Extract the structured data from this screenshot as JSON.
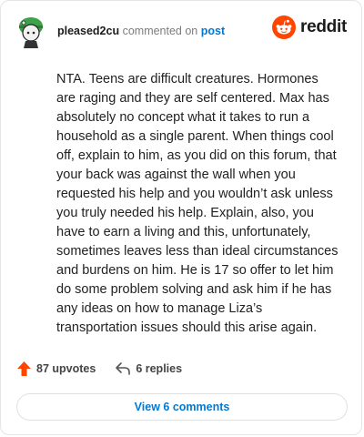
{
  "comment": {
    "username": "pleased2cu",
    "verb": "commented on",
    "post_link": "post",
    "body": "NTA. Teens are difficult creatures. Hormones are raging and they are self centered. Max has absolutely no concept what it takes to run a household as a single parent. When things cool off, explain to him, as you did on this forum, that your back was against the wall when you requested his help and you wouldn’t ask unless you truly needed his help. Explain, also, you have to earn a living and this, unfortunately, sometimes leaves less than ideal circumstances and burdens on him. He is 17 so offer to let him do some problem solving and ask him if he has any ideas on how to manage Liza’s transportation issues should this arise again.",
    "upvotes": "87 upvotes",
    "replies": "6 replies",
    "view_comments": "View 6 comments"
  },
  "brand": {
    "logo_text": "reddit",
    "accent": "#ff4500",
    "link": "#0079d3"
  },
  "icons": {
    "avatar": "avatar-icon",
    "logo": "reddit-logo-icon",
    "upvote": "upvote-arrow-icon",
    "reply": "reply-icon"
  }
}
